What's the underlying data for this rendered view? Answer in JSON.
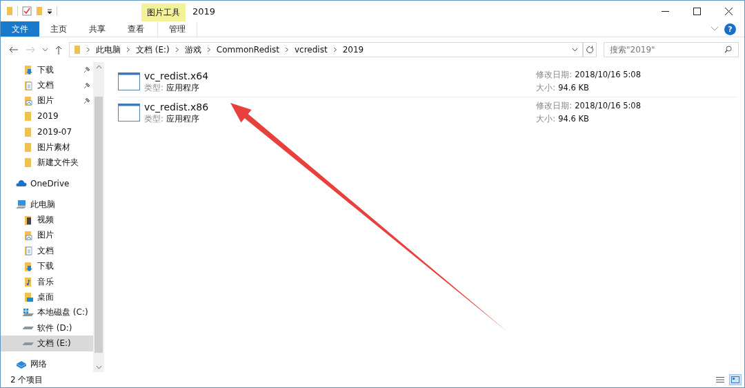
{
  "window": {
    "title": "2019",
    "context_tab_group": "图片工具"
  },
  "ribbon_tabs": [
    {
      "label": "文件",
      "kind": "file"
    },
    {
      "label": "主页",
      "kind": "normal"
    },
    {
      "label": "共享",
      "kind": "normal"
    },
    {
      "label": "查看",
      "kind": "normal"
    },
    {
      "label": "管理",
      "kind": "contextual"
    }
  ],
  "help": "?",
  "breadcrumb": [
    "此电脑",
    "文档 (E:)",
    "游戏",
    "CommonRedist",
    "vcredist",
    "2019"
  ],
  "search": {
    "placeholder": "搜索\"2019\""
  },
  "sidebar": {
    "quick_access": [
      {
        "label": "下载",
        "kind": "download",
        "pinned": true,
        "selected": false
      },
      {
        "label": "文档",
        "kind": "document",
        "pinned": true,
        "selected": false
      },
      {
        "label": "图片",
        "kind": "picture",
        "pinned": true,
        "selected": false
      },
      {
        "label": "2019",
        "kind": "folder",
        "pinned": false,
        "selected": false
      },
      {
        "label": "2019-07",
        "kind": "folder",
        "pinned": false,
        "selected": false
      },
      {
        "label": "图片素材",
        "kind": "folder",
        "pinned": false,
        "selected": false
      },
      {
        "label": "新建文件夹",
        "kind": "folder",
        "pinned": false,
        "selected": false
      }
    ],
    "tree": [
      {
        "label": "OneDrive",
        "kind": "cloud",
        "selected": false
      },
      {
        "label": "此电脑",
        "kind": "computer",
        "selected": false,
        "children": [
          {
            "label": "视频",
            "kind": "video",
            "selected": false
          },
          {
            "label": "图片",
            "kind": "picture",
            "selected": false
          },
          {
            "label": "文档",
            "kind": "document",
            "selected": false
          },
          {
            "label": "下载",
            "kind": "download",
            "selected": false
          },
          {
            "label": "音乐",
            "kind": "music",
            "selected": false
          },
          {
            "label": "桌面",
            "kind": "desktop",
            "selected": false
          },
          {
            "label": "本地磁盘 (C:)",
            "kind": "system-drive",
            "selected": false
          },
          {
            "label": "软件 (D:)",
            "kind": "drive",
            "selected": false
          },
          {
            "label": "文档 (E:)",
            "kind": "drive",
            "selected": true
          }
        ]
      },
      {
        "label": "网络",
        "kind": "network",
        "selected": false
      }
    ]
  },
  "files": [
    {
      "name": "vc_redist.x64",
      "type_label": "类型:",
      "type": "应用程序",
      "date_label": "修改日期:",
      "date": "2018/10/16 5:08",
      "size_label": "大小:",
      "size": "94.6 KB"
    },
    {
      "name": "vc_redist.x86",
      "type_label": "类型:",
      "type": "应用程序",
      "date_label": "修改日期:",
      "date": "2018/10/16 5:08",
      "size_label": "大小:",
      "size": "94.6 KB"
    }
  ],
  "status_bar": {
    "count": "2 个项目",
    "views": [
      {
        "kind": "details",
        "selected": false
      },
      {
        "kind": "tiles",
        "selected": true
      }
    ]
  }
}
